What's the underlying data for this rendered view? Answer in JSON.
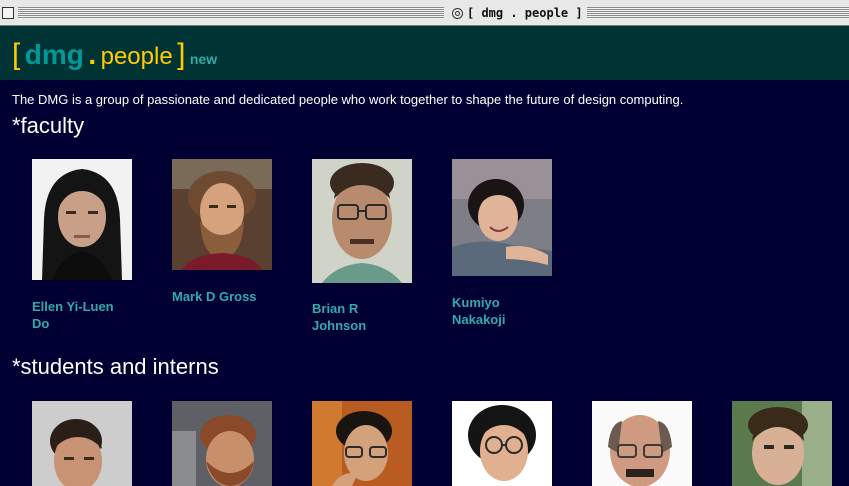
{
  "window": {
    "title": "[ dmg . people ]"
  },
  "header": {
    "bracket_open": "[",
    "dmg": "dmg",
    "dot": ".",
    "people": "people",
    "bracket_close": "]",
    "new_link": "new"
  },
  "intro": "The DMG is a group of passionate and dedicated people who work together to shape the future of design computing.",
  "sections": {
    "faculty": "*faculty",
    "students": "*students and interns"
  },
  "faculty": [
    {
      "name": "Ellen Yi-Luen Do"
    },
    {
      "name": "Mark D Gross"
    },
    {
      "name": "Brian R Johnson"
    },
    {
      "name": "Kumiyo Nakakoji"
    }
  ],
  "colors": {
    "page_bg": "#000033",
    "header_bg": "#003333",
    "accent_yellow": "#ffcc00",
    "accent_teal": "#009999",
    "link": "#33aaaa"
  }
}
